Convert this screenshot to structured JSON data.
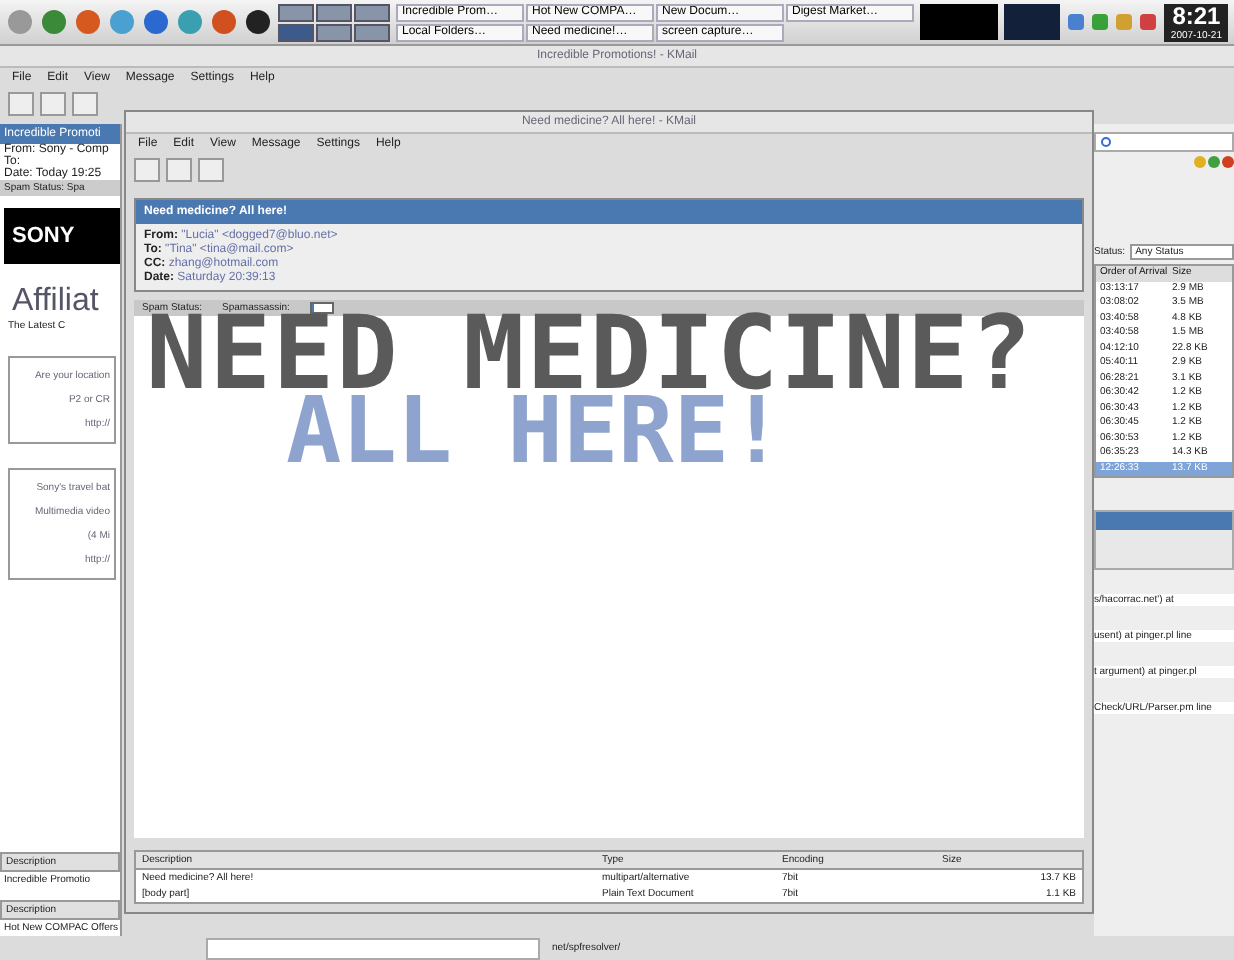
{
  "taskbar": {
    "tasks": [
      {
        "label": "Incredible Prom…"
      },
      {
        "label": "Hot New COMPA…"
      },
      {
        "label": "New Docum…"
      },
      {
        "label": "Digest Market…"
      },
      {
        "label": "Local Folders…"
      },
      {
        "label": "Need medicine!…"
      },
      {
        "label": "screen capture…"
      }
    ],
    "clock": {
      "time": "8:21",
      "date": "2007-10-21"
    }
  },
  "back_window": {
    "title": "Incredible Promotions! - KMail",
    "menu": [
      "File",
      "Edit",
      "View",
      "Message",
      "Settings",
      "Help"
    ],
    "left_pane": {
      "header": "Incredible Promoti",
      "fields": [
        "From: Sony - Comp",
        "To:",
        "Date: Today 19:25"
      ],
      "spam": "Spam Status:  Spa",
      "logo": "SONY",
      "heading": "Affiliat",
      "bullet": "The Latest C",
      "blocks": [
        [
          "Are your location",
          "P2 or CR",
          "http://"
        ],
        [
          "Sony's travel bat",
          "Multimedia video",
          "(4 Mi",
          "http://"
        ]
      ],
      "desc1": "Description",
      "item1": "Incredible Promotio",
      "desc2": "Description",
      "item2": "Hot New COMPAC Offers"
    },
    "right_pane": {
      "status_label": "Status:",
      "status_value": "Any Status",
      "columns": [
        "Order of Arrival",
        "Size"
      ],
      "rows": [
        {
          "time": "03:13:17",
          "size": "2.9 MB",
          "selected": false
        },
        {
          "time": "03:08:02",
          "size": "3.5 MB",
          "selected": false
        },
        {
          "time": "03:40:58",
          "size": "4.8 KB",
          "selected": false
        },
        {
          "time": "03:40:58",
          "size": "1.5 MB",
          "selected": false
        },
        {
          "time": "04:12:10",
          "size": "22.8 KB",
          "selected": false
        },
        {
          "time": "05:40:11",
          "size": "2.9 KB",
          "selected": false
        },
        {
          "time": "06:28:21",
          "size": "3.1 KB",
          "selected": false
        },
        {
          "time": "06:30:42",
          "size": "1.2 KB",
          "selected": false
        },
        {
          "time": "06:30:43",
          "size": "1.2 KB",
          "selected": false
        },
        {
          "time": "06:30:45",
          "size": "1.2 KB",
          "selected": false
        },
        {
          "time": "06:30:53",
          "size": "1.2 KB",
          "selected": false
        },
        {
          "time": "06:35:23",
          "size": "14.3 KB",
          "selected": false
        },
        {
          "time": "12:26:33",
          "size": "13.7 KB",
          "selected": true
        }
      ],
      "log": [
        "s/hacorrac.net') at",
        "usent) at pinger.pl line",
        "t argument) at pinger.pl",
        "Check/URL/Parser.pm line"
      ]
    },
    "path": "net/spfresolver/"
  },
  "window": {
    "title": "Need medicine? All here! - KMail",
    "menu": [
      "File",
      "Edit",
      "View",
      "Message",
      "Settings",
      "Help"
    ],
    "header": {
      "subject": "Need medicine? All here!",
      "fields": [
        {
          "label": "From:",
          "value": "\"Lucia\" <dogged7@bluo.net>"
        },
        {
          "label": "To:",
          "value": "\"Tina\" <tina@mail.com>"
        },
        {
          "label": "CC:",
          "value": "zhang@hotmail.com"
        },
        {
          "label": "Date:",
          "value": "Saturday 20:39:13"
        }
      ],
      "spam_status": "Spam Status:",
      "spam_tool": "Spamassassin:",
      "spam_meter": {
        "level": 0.1
      }
    },
    "body": {
      "line1": "NEED MEDICINE?",
      "line2": "ALL HERE!"
    },
    "attachments": {
      "columns": [
        "Description",
        "Type",
        "Encoding",
        "Size"
      ],
      "rows": [
        {
          "description": "Need medicine? All here!",
          "type": "multipart/alternative",
          "encoding": "7bit",
          "size": "13.7 KB"
        },
        {
          "description": "[body part]",
          "type": "Plain Text Document",
          "encoding": "7bit",
          "size": "1.1 KB"
        }
      ]
    }
  }
}
